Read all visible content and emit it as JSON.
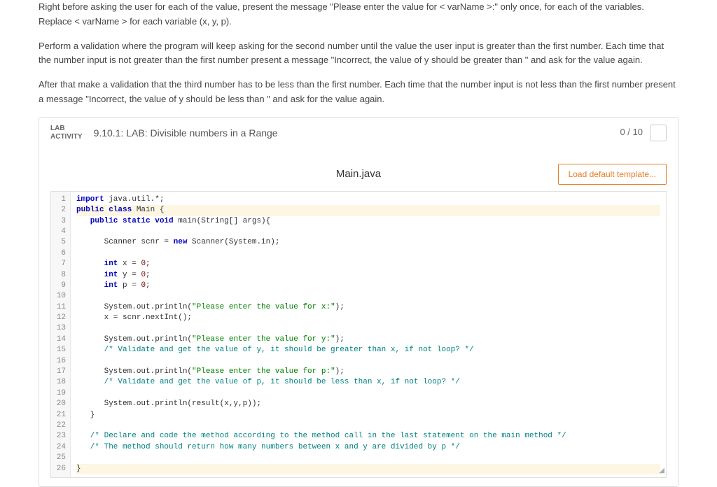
{
  "instructions": {
    "p1": "Right before asking the user for each of the value, present the message \"Please enter the value for < varName >:\" only once, for each of the variables. Replace < varName > for each variable (x, y, p).",
    "p2": "Perform a validation where the program will keep asking for the second number until the value the user input is greater than the first number. Each time that the number input is not greater than the first number present a message \"Incorrect, the value of y should be greater than \" and ask for the value again.",
    "p3": "After that make a validation that the third number has to be less than the first number. Each time that the number input is not less than the first number present a message \"Incorrect, the value of y should be less than \" and ask for the value again."
  },
  "activity": {
    "tagLine1": "LAB",
    "tagLine2": "ACTIVITY",
    "title": "9.10.1: LAB: Divisible numbers in a Range",
    "score": "0 / 10"
  },
  "editor": {
    "fileName": "Main.java",
    "loadTemplate": "Load default template...",
    "lineCount": 26,
    "code": {
      "l1": {
        "a": "import",
        "b": " java.util.*;"
      },
      "l2": {
        "a": "public class",
        "b": " Main {"
      },
      "l3": {
        "a": "   public static void",
        "b": " main(String[] args){"
      },
      "l4": "",
      "l5": {
        "a": "      Scanner scnr = ",
        "b": "new",
        "c": " Scanner(System.in);"
      },
      "l6": "",
      "l7": {
        "a": "      int",
        "b": " x = ",
        "c": "0",
        "d": ";"
      },
      "l8": {
        "a": "      int",
        "b": " y = ",
        "c": "0",
        "d": ";"
      },
      "l9": {
        "a": "      int",
        "b": " p = ",
        "c": "0",
        "d": ";"
      },
      "l10": "",
      "l11": {
        "a": "      System.out.println(",
        "b": "\"Please enter the value for x:\"",
        "c": ");"
      },
      "l12": "      x = scnr.nextInt();",
      "l13": "",
      "l14": {
        "a": "      System.out.println(",
        "b": "\"Please enter the value for y:\"",
        "c": ");"
      },
      "l15": "      /* Validate and get the value of y, it should be greater than x, if not loop? */",
      "l16": "",
      "l17": {
        "a": "      System.out.println(",
        "b": "\"Please enter the value for p:\"",
        "c": ");"
      },
      "l18": "      /* Validate and get the value of p, it should be less than x, if not loop? */",
      "l19": "",
      "l20": "      System.out.println(result(x,y,p));",
      "l21": "   }",
      "l22": "",
      "l23": "   /* Declare and code the method according to the method call in the last statement on the main method */",
      "l24": "   /* The method should return how many numbers between x and y are divided by p */",
      "l25": "",
      "l26": "}"
    }
  }
}
